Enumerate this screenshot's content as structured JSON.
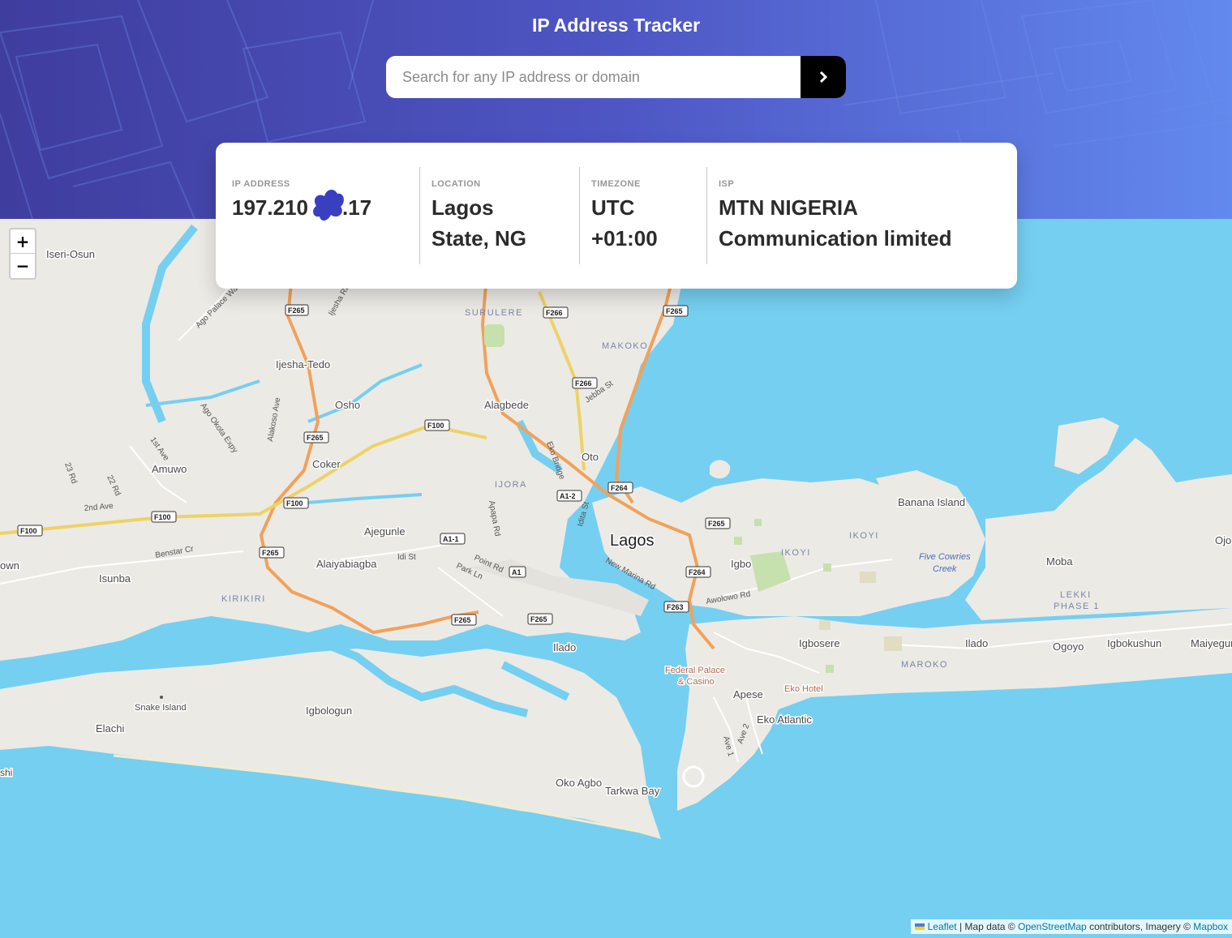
{
  "app": {
    "title": "IP Address Tracker"
  },
  "search": {
    "placeholder": "Search for any IP address or domain",
    "value": "",
    "button_icon": "chevron-right-icon"
  },
  "info": {
    "ip_label": "IP ADDRESS",
    "ip_prefix": "197.210",
    "ip_suffix": ".17",
    "location_label": "LOCATION",
    "location_line1": "Lagos",
    "location_line2": "State, NG",
    "timezone_label": "TIMEZONE",
    "timezone_line1": "UTC",
    "timezone_line2": "+01:00",
    "isp_label": "ISP",
    "isp_line1": "MTN NIGERIA",
    "isp_line2": "Communication limited"
  },
  "map": {
    "zoom_in": "+",
    "zoom_out": "−",
    "city": "Lagos",
    "places": {
      "iseri_osun": "Iseri-Osun",
      "ijesha_tedo": "Ijesha-Tedo",
      "osho": "Osho",
      "alagbede": "Alagbede",
      "amuwo": "Amuwo",
      "coker": "Coker",
      "oto": "Oto",
      "ajegunle": "Ajegunle",
      "alaiyabiagba": "Alaiyabiagba",
      "isunba": "Isunba",
      "ilado": "Ilado",
      "snake_island": "Snake Island",
      "elachi": "Elachi",
      "igbologun": "Igbologun",
      "oko_agbo": "Oko Agbo",
      "tarkwa_bay": "Tarkwa Bay",
      "igbo": "Igbo",
      "igbosere": "Igbosere",
      "apese": "Apese",
      "eko_atlantic": "Eko Atlantic",
      "eko_hotel": "Eko Hotel",
      "federal_palace_1": "Federal Palace",
      "federal_palace_2": "& Casino",
      "banana_island": "Banana Island",
      "moba": "Moba",
      "ilado_east": "Ilado",
      "ogoyo": "Ogoyo",
      "igbokushun": "Igbokushun",
      "maiyegun": "Maiyegur",
      "ojo": "Ojo",
      "own": "own",
      "shi": "shi"
    },
    "districts": {
      "surulere": "SURULERE",
      "makoko": "MAKOKO",
      "ijora": "IJORA",
      "kirikiri": "KIRIKIRI",
      "ikoyi_a": "IKOYI",
      "ikoyi_b": "IKOYI",
      "maroko": "MAROKO",
      "lekki1": "LEKKI",
      "lekki2": "PHASE 1",
      "five_cowries1": "Five Cowries",
      "five_cowries2": "Creek"
    },
    "roads": {
      "ago_palace": "Ago Palace Wa",
      "ijesha_rd": "Ijesha Rd",
      "ago_okota": "Ago Okota Expy",
      "alakoso": "Alakoso Ave",
      "first_ave": "1st Ave",
      "rd23": "23 Rd",
      "rd22": "22 Rd",
      "second_ave": "2nd Ave",
      "benstar": "Benstar Cr",
      "idi_st": "Idi St",
      "point_rd": "Point Rd",
      "park_ln": "Park Ln",
      "apapa_rd": "Apapa Rd",
      "eko_bridge": "Eko Bridge",
      "jebba_st": "Jebba St",
      "idita_st": "Idita St",
      "new_marina": "New Marina Rd",
      "awolowo": "Awolowo Rd",
      "ave1": "Ave 1",
      "ave2": "Ave 2"
    },
    "shields": {
      "f265": "F265",
      "f266": "F266",
      "f100": "F100",
      "f264": "F264",
      "f263": "F263",
      "a1": "A1",
      "a1_1": "A1-1",
      "a1_2": "A1-2"
    }
  },
  "attribution": {
    "leaflet": "Leaflet",
    "map_data": "| Map data ©",
    "osm": "OpenStreetMap",
    "contributors": "contributors, Imagery ©",
    "mapbox": "Mapbox"
  },
  "colors": {
    "header_start": "#3f3d9e",
    "header_end": "#6289ee",
    "water": "#75cff0",
    "land": "#eceae5",
    "motorway": "#f2a15a",
    "trunk": "#eed264"
  }
}
